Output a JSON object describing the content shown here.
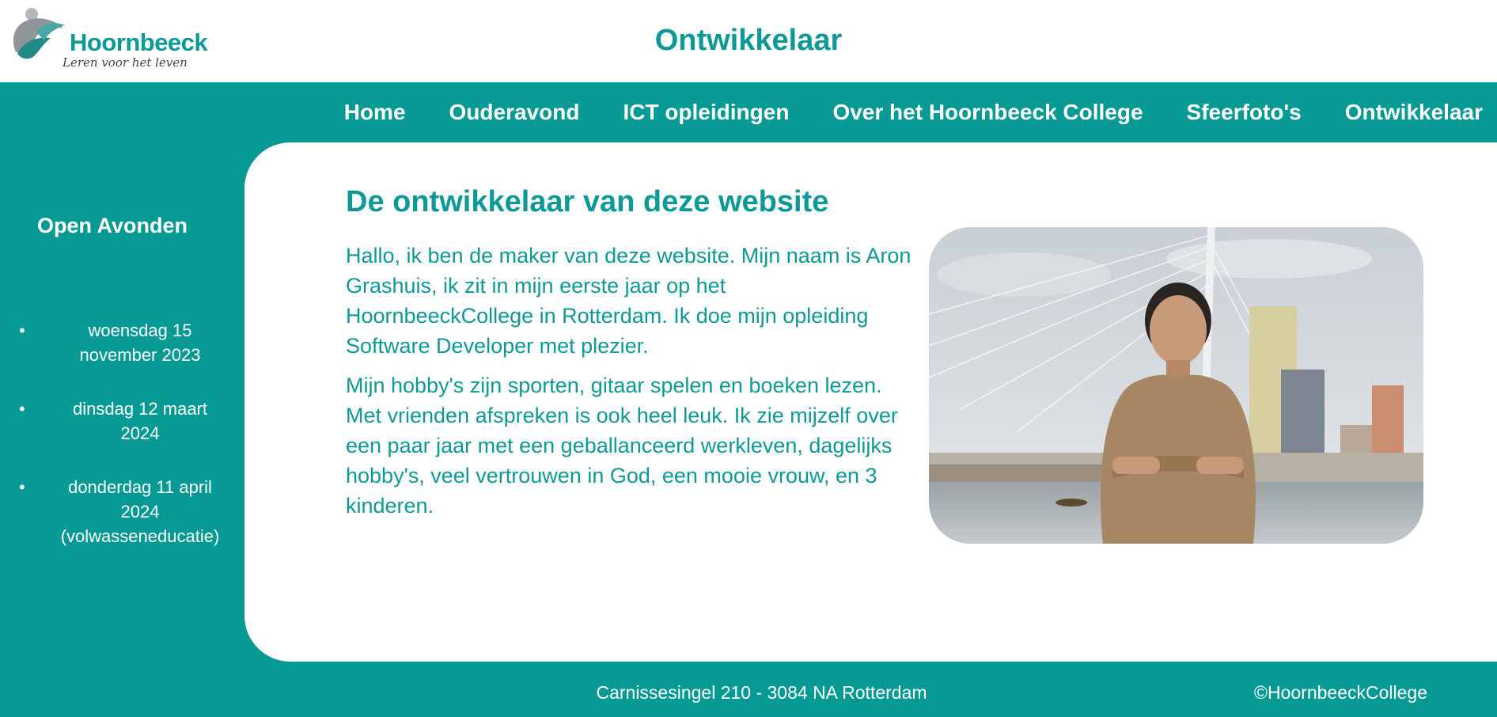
{
  "header": {
    "logo_name": "Hoornbeeck",
    "logo_tagline": "Leren voor het leven",
    "site_title": "Ontwikkelaar"
  },
  "nav": {
    "items": [
      {
        "label": "Home"
      },
      {
        "label": "Ouderavond"
      },
      {
        "label": "ICT opleidingen"
      },
      {
        "label": "Over het Hoornbeeck College"
      },
      {
        "label": "Sfeerfoto's"
      },
      {
        "label": "Ontwikkelaar"
      }
    ]
  },
  "sidebar": {
    "title": "Open Avonden",
    "events": [
      {
        "line1": "woensdag 15",
        "line2": "november 2023",
        "line3": ""
      },
      {
        "line1": "dinsdag 12 maart",
        "line2": "2024",
        "line3": ""
      },
      {
        "line1": "donderdag 11 april",
        "line2": "2024",
        "line3": "(volwasseneducatie)"
      }
    ]
  },
  "main": {
    "title": "De ontwikkelaar van deze website",
    "paragraph1": "Hallo, ik ben de maker van deze website. Mijn naam is Aron Grashuis, ik zit in mijn eerste jaar op het HoornbeeckCollege in Rotterdam. Ik doe mijn opleiding Software Developer met plezier.",
    "paragraph2": "Mijn hobby's zijn sporten, gitaar spelen en boeken lezen. Met vrienden afspreken is ook heel leuk. Ik zie mijzelf over een paar jaar met een geballanceerd werkleven, dagelijks hobby's, veel vertrouwen in God, een mooie vrouw, en 3 kinderen."
  },
  "footer": {
    "address": "Carnissesingel 210 - 3084 NA Rotterdam",
    "copyright": "©HoornbeeckCollege"
  },
  "colors": {
    "brand_teal": "#079994",
    "text_teal": "#0d9a96",
    "background": "#ffffff"
  }
}
